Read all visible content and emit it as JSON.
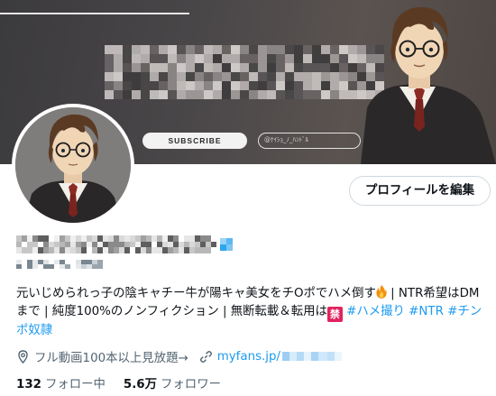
{
  "banner": {
    "subscribe_label": "SUBSCRIBE",
    "handle_pill_text": "@ﾅｲｼｮ_ﾉ_ﾊﾝﾄﾞﾙ"
  },
  "profile": {
    "edit_button_label": "プロフィールを編集",
    "bio": {
      "text1": "元いじめられっ子の陰キャチー牛が陽キャ美女をチOポでハメ倒す",
      "text2": " | NTR希望はDMまで | 純度100%のノンフィクション | 無断転載＆転用は",
      "kin": "禁",
      "tag1": " #ハメ撮り",
      "tag2": " #NTR",
      "tag3": " #チンポ奴隷"
    },
    "meta": {
      "location_text": "フル動画100本以上見放題→",
      "link_text": "myfans.jp/"
    },
    "follows": {
      "following_count": "132",
      "following_label": "フォロー中",
      "followers_count": "5.6万",
      "followers_label": "フォロワー"
    }
  },
  "colors": {
    "accent": "#1d9bf0",
    "text": "#0f1419",
    "muted": "#536471",
    "badge_red": "#e0245e"
  }
}
